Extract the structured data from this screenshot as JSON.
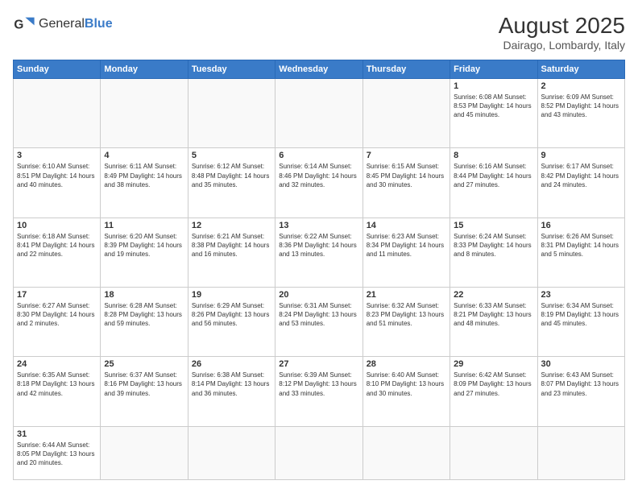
{
  "header": {
    "logo_general": "General",
    "logo_blue": "Blue",
    "month_year": "August 2025",
    "location": "Dairago, Lombardy, Italy"
  },
  "weekdays": [
    "Sunday",
    "Monday",
    "Tuesday",
    "Wednesday",
    "Thursday",
    "Friday",
    "Saturday"
  ],
  "weeks": [
    [
      {
        "day": "",
        "info": ""
      },
      {
        "day": "",
        "info": ""
      },
      {
        "day": "",
        "info": ""
      },
      {
        "day": "",
        "info": ""
      },
      {
        "day": "",
        "info": ""
      },
      {
        "day": "1",
        "info": "Sunrise: 6:08 AM\nSunset: 8:53 PM\nDaylight: 14 hours and 45 minutes."
      },
      {
        "day": "2",
        "info": "Sunrise: 6:09 AM\nSunset: 8:52 PM\nDaylight: 14 hours and 43 minutes."
      }
    ],
    [
      {
        "day": "3",
        "info": "Sunrise: 6:10 AM\nSunset: 8:51 PM\nDaylight: 14 hours and 40 minutes."
      },
      {
        "day": "4",
        "info": "Sunrise: 6:11 AM\nSunset: 8:49 PM\nDaylight: 14 hours and 38 minutes."
      },
      {
        "day": "5",
        "info": "Sunrise: 6:12 AM\nSunset: 8:48 PM\nDaylight: 14 hours and 35 minutes."
      },
      {
        "day": "6",
        "info": "Sunrise: 6:14 AM\nSunset: 8:46 PM\nDaylight: 14 hours and 32 minutes."
      },
      {
        "day": "7",
        "info": "Sunrise: 6:15 AM\nSunset: 8:45 PM\nDaylight: 14 hours and 30 minutes."
      },
      {
        "day": "8",
        "info": "Sunrise: 6:16 AM\nSunset: 8:44 PM\nDaylight: 14 hours and 27 minutes."
      },
      {
        "day": "9",
        "info": "Sunrise: 6:17 AM\nSunset: 8:42 PM\nDaylight: 14 hours and 24 minutes."
      }
    ],
    [
      {
        "day": "10",
        "info": "Sunrise: 6:18 AM\nSunset: 8:41 PM\nDaylight: 14 hours and 22 minutes."
      },
      {
        "day": "11",
        "info": "Sunrise: 6:20 AM\nSunset: 8:39 PM\nDaylight: 14 hours and 19 minutes."
      },
      {
        "day": "12",
        "info": "Sunrise: 6:21 AM\nSunset: 8:38 PM\nDaylight: 14 hours and 16 minutes."
      },
      {
        "day": "13",
        "info": "Sunrise: 6:22 AM\nSunset: 8:36 PM\nDaylight: 14 hours and 13 minutes."
      },
      {
        "day": "14",
        "info": "Sunrise: 6:23 AM\nSunset: 8:34 PM\nDaylight: 14 hours and 11 minutes."
      },
      {
        "day": "15",
        "info": "Sunrise: 6:24 AM\nSunset: 8:33 PM\nDaylight: 14 hours and 8 minutes."
      },
      {
        "day": "16",
        "info": "Sunrise: 6:26 AM\nSunset: 8:31 PM\nDaylight: 14 hours and 5 minutes."
      }
    ],
    [
      {
        "day": "17",
        "info": "Sunrise: 6:27 AM\nSunset: 8:30 PM\nDaylight: 14 hours and 2 minutes."
      },
      {
        "day": "18",
        "info": "Sunrise: 6:28 AM\nSunset: 8:28 PM\nDaylight: 13 hours and 59 minutes."
      },
      {
        "day": "19",
        "info": "Sunrise: 6:29 AM\nSunset: 8:26 PM\nDaylight: 13 hours and 56 minutes."
      },
      {
        "day": "20",
        "info": "Sunrise: 6:31 AM\nSunset: 8:24 PM\nDaylight: 13 hours and 53 minutes."
      },
      {
        "day": "21",
        "info": "Sunrise: 6:32 AM\nSunset: 8:23 PM\nDaylight: 13 hours and 51 minutes."
      },
      {
        "day": "22",
        "info": "Sunrise: 6:33 AM\nSunset: 8:21 PM\nDaylight: 13 hours and 48 minutes."
      },
      {
        "day": "23",
        "info": "Sunrise: 6:34 AM\nSunset: 8:19 PM\nDaylight: 13 hours and 45 minutes."
      }
    ],
    [
      {
        "day": "24",
        "info": "Sunrise: 6:35 AM\nSunset: 8:18 PM\nDaylight: 13 hours and 42 minutes."
      },
      {
        "day": "25",
        "info": "Sunrise: 6:37 AM\nSunset: 8:16 PM\nDaylight: 13 hours and 39 minutes."
      },
      {
        "day": "26",
        "info": "Sunrise: 6:38 AM\nSunset: 8:14 PM\nDaylight: 13 hours and 36 minutes."
      },
      {
        "day": "27",
        "info": "Sunrise: 6:39 AM\nSunset: 8:12 PM\nDaylight: 13 hours and 33 minutes."
      },
      {
        "day": "28",
        "info": "Sunrise: 6:40 AM\nSunset: 8:10 PM\nDaylight: 13 hours and 30 minutes."
      },
      {
        "day": "29",
        "info": "Sunrise: 6:42 AM\nSunset: 8:09 PM\nDaylight: 13 hours and 27 minutes."
      },
      {
        "day": "30",
        "info": "Sunrise: 6:43 AM\nSunset: 8:07 PM\nDaylight: 13 hours and 23 minutes."
      }
    ],
    [
      {
        "day": "31",
        "info": "Sunrise: 6:44 AM\nSunset: 8:05 PM\nDaylight: 13 hours and 20 minutes."
      },
      {
        "day": "",
        "info": ""
      },
      {
        "day": "",
        "info": ""
      },
      {
        "day": "",
        "info": ""
      },
      {
        "day": "",
        "info": ""
      },
      {
        "day": "",
        "info": ""
      },
      {
        "day": "",
        "info": ""
      }
    ]
  ]
}
